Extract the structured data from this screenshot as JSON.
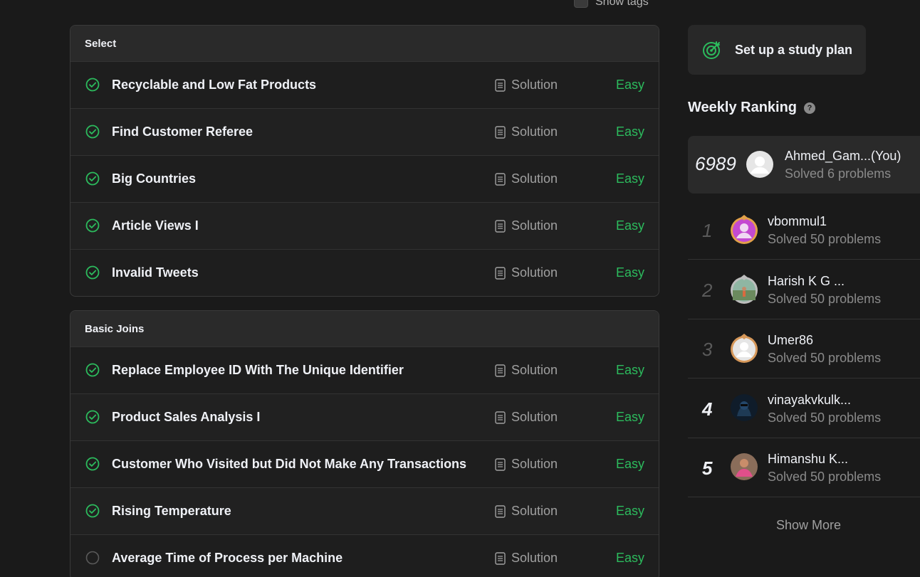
{
  "show_tags_label": "Show tags",
  "sections": [
    {
      "title": "Select",
      "problems": [
        {
          "title": "Recyclable and Low Fat Products",
          "solution": "Solution",
          "difficulty": "Easy",
          "solved": true
        },
        {
          "title": "Find Customer Referee",
          "solution": "Solution",
          "difficulty": "Easy",
          "solved": true
        },
        {
          "title": "Big Countries",
          "solution": "Solution",
          "difficulty": "Easy",
          "solved": true
        },
        {
          "title": "Article Views I",
          "solution": "Solution",
          "difficulty": "Easy",
          "solved": true
        },
        {
          "title": "Invalid Tweets",
          "solution": "Solution",
          "difficulty": "Easy",
          "solved": true
        }
      ]
    },
    {
      "title": "Basic Joins",
      "problems": [
        {
          "title": "Replace Employee ID With The Unique Identifier",
          "solution": "Solution",
          "difficulty": "Easy",
          "solved": true
        },
        {
          "title": "Product Sales Analysis I",
          "solution": "Solution",
          "difficulty": "Easy",
          "solved": true
        },
        {
          "title": "Customer Who Visited but Did Not Make Any Transactions",
          "solution": "Solution",
          "difficulty": "Easy",
          "solved": true
        },
        {
          "title": "Rising Temperature",
          "solution": "Solution",
          "difficulty": "Easy",
          "solved": true
        },
        {
          "title": "Average Time of Process per Machine",
          "solution": "Solution",
          "difficulty": "Easy",
          "solved": false
        }
      ]
    }
  ],
  "study_plan_label": "Set up a study plan",
  "weekly_ranking": {
    "title": "Weekly Ranking",
    "help_icon": "?",
    "you": {
      "rank": "6989",
      "name": "Ahmed_Gam...(You)",
      "solved": "Solved 6 problems"
    },
    "entries": [
      {
        "rank": "1",
        "name": "vbommul1",
        "solved": "Solved 50 problems"
      },
      {
        "rank": "2",
        "name": "Harish K G ...",
        "solved": "Solved 50 problems"
      },
      {
        "rank": "3",
        "name": "Umer86",
        "solved": "Solved 50 problems"
      },
      {
        "rank": "4",
        "name": "vinayakvkulk...",
        "solved": "Solved 50 problems"
      },
      {
        "rank": "5",
        "name": "Himanshu K...",
        "solved": "Solved 50 problems"
      }
    ],
    "show_more": "Show More"
  },
  "colors": {
    "easy": "#2cbb5d",
    "accent": "#2cbb5d",
    "background": "#1a1a1a"
  }
}
